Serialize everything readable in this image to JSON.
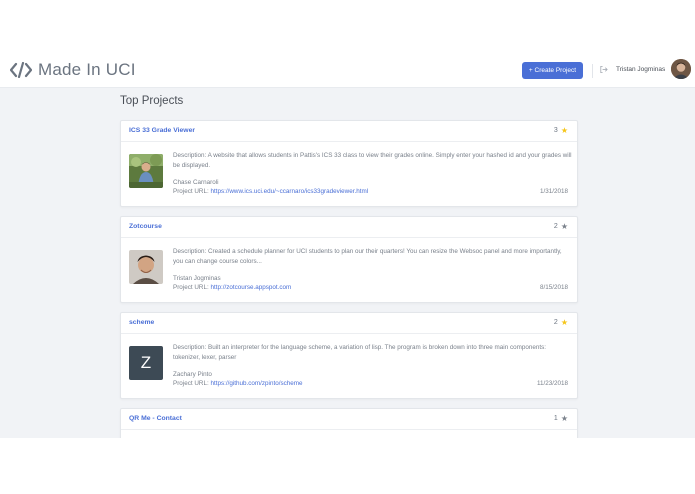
{
  "header": {
    "logo_text": "Made In UCI",
    "create_label": "+ Create Project",
    "user_name": "Tristan Jogminas"
  },
  "main": {
    "section_title": "Top Projects",
    "desc_prefix": "Description:",
    "url_prefix": "Project URL:"
  },
  "projects": [
    {
      "title": "ICS 33 Grade Viewer",
      "rating": "3",
      "star_color": "#f5c518",
      "description": "A website that allows students in Pattis's ICS 33 class to view their grades online. Simply enter your hashed id and your grades will be displayed.",
      "author": "Chase Carnaroli",
      "url": "https://www.ics.uci.edu/~ccarnaro/ics33gradeviewer.html",
      "date": "1/31/2018"
    },
    {
      "title": "Zotcourse",
      "rating": "2",
      "star_color": "#7a818b",
      "description": "Created a schedule planner for UCI students to plan our their quarters! You can resize the Websoc panel and more importantly, you can change course colors...",
      "author": "Tristan Jogminas",
      "url": "http://zotcourse.appspot.com",
      "date": "8/15/2018"
    },
    {
      "title": "scheme",
      "rating": "2",
      "star_color": "#f5c518",
      "description": "Built an interpreter for the language scheme, a variation of lisp. The program is broken down into three main components: tokenizer, lexer, parser",
      "author": "Zachary Pinto",
      "url": "https://github.com/zpinto/scheme",
      "date": "11/23/2018",
      "letter": "Z"
    },
    {
      "title": "QR Me - Contact",
      "rating": "1",
      "star_color": "#7a818b"
    }
  ]
}
